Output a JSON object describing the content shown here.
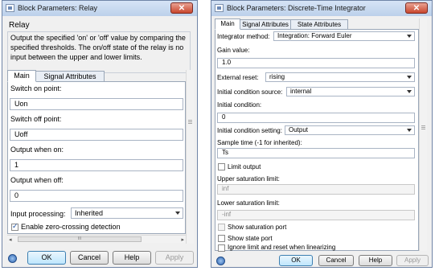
{
  "relay": {
    "title": "Block Parameters: Relay",
    "block_name": "Relay",
    "description_lines": [
      "Output the specified 'on' or 'off' value by comparing the",
      "specified thresholds.  The on/off state of the relay is no",
      "input between the upper and lower limits."
    ],
    "tabs": [
      "Main",
      "Signal Attributes"
    ],
    "switch_on_label": "Switch on point:",
    "switch_on_value": "Uon",
    "switch_off_label": "Switch off point:",
    "switch_off_value": "Uoff",
    "output_on_label": "Output when on:",
    "output_on_value": "1",
    "output_off_label": "Output when off:",
    "output_off_value": "0",
    "input_processing_label": "Input processing:",
    "input_processing_value": "Inherited",
    "zero_crossing_label": "Enable zero-crossing detection",
    "zero_crossing_checked": true,
    "hscroll_mark": "III",
    "buttons": {
      "ok": "OK",
      "cancel": "Cancel",
      "help": "Help",
      "apply": "Apply"
    }
  },
  "dti": {
    "title": "Block Parameters: Discrete-Time Integrator",
    "tabs": [
      "Main",
      "Signal Attributes",
      "State Attributes"
    ],
    "integrator_method_label": "Integrator method:",
    "integrator_method_value": "Integration: Forward Euler",
    "gain_label": "Gain value:",
    "gain_value": "1.0",
    "external_reset_label": "External reset:",
    "external_reset_value": "rising",
    "ic_source_label": "Initial condition source:",
    "ic_source_value": "internal",
    "ic_label": "Initial condition:",
    "ic_value": "0",
    "ic_setting_label": "Initial condition setting:",
    "ic_setting_value": "Output",
    "sample_time_label": "Sample time (-1 for inherited):",
    "sample_time_value": "Ts",
    "limit_output_label": "Limit output",
    "upper_sat_label": "Upper saturation limit:",
    "upper_sat_value": "inf",
    "lower_sat_label": "Lower saturation limit:",
    "lower_sat_value": "-inf",
    "show_sat_port_label": "Show saturation port",
    "show_state_port_label": "Show state port",
    "ignore_limit_label": "Ignore limit and reset when linearizing",
    "buttons": {
      "ok": "OK",
      "cancel": "Cancel",
      "help": "Help",
      "apply": "Apply"
    }
  }
}
